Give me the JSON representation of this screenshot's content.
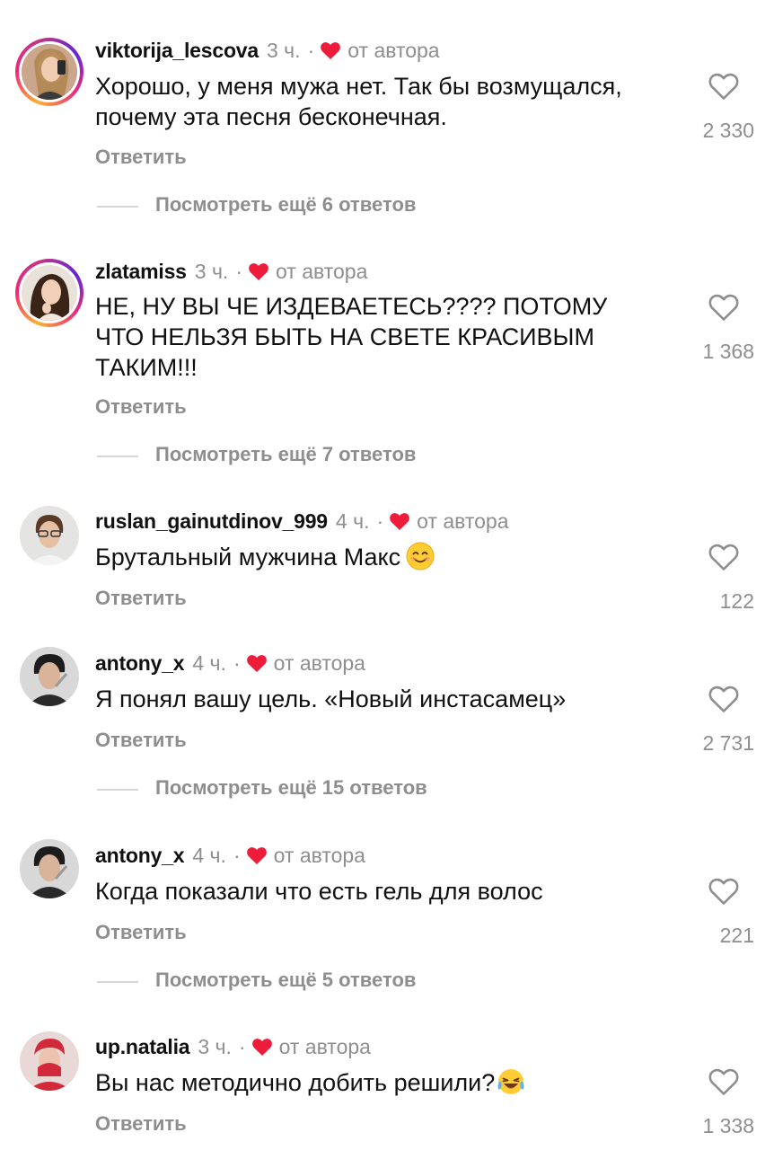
{
  "common": {
    "reply_label": "Ответить",
    "author_label": "от автора",
    "separator": "·"
  },
  "comments": [
    {
      "username": "viktorija_lescova",
      "time": "3 ч.",
      "text": "Хорошо, у меня мужа нет. Так бы возмущался, почему эта песня бесконечная.",
      "likes": "2 330",
      "more_replies": "Посмотреть ещё 6 ответов",
      "avatar": "avatar-photo-woman-blonde"
    },
    {
      "username": "zlatamiss",
      "time": "3 ч.",
      "text": "НЕ, НУ ВЫ ЧЕ ИЗДЕВАЕТЕСЬ???? ПОТОМУ ЧТО НЕЛЬЗЯ БЫТЬ НА СВЕТЕ КРАСИВЫМ ТАКИМ!!!",
      "likes": "1 368",
      "more_replies": "Посмотреть ещё 7 ответов",
      "avatar": "avatar-photo-woman-brunette"
    },
    {
      "username": "ruslan_gainutdinov_999",
      "time": "4 ч.",
      "text": "Брутальный мужчина Макс",
      "emoji": "smiling-face-emoji",
      "likes": "122",
      "avatar": "avatar-photo-man-glasses"
    },
    {
      "username": "antony_x",
      "time": "4 ч.",
      "text": "Я понял вашу цель. «Новый инстасамец»",
      "likes": "2 731",
      "more_replies": "Посмотреть ещё 15 ответов",
      "avatar": "avatar-photo-man-dark"
    },
    {
      "username": "antony_x",
      "time": "4 ч.",
      "text": "Когда показали что есть гель для волос",
      "likes": "221",
      "more_replies": "Посмотреть ещё 5 ответов",
      "avatar": "avatar-photo-man-dark"
    },
    {
      "username": "up.natalia",
      "time": "3 ч.",
      "text": "Вы нас методично добить решили?",
      "emoji": "tears-of-joy-emoji",
      "likes": "1 338",
      "avatar": "avatar-photo-woman-red"
    }
  ],
  "colors": {
    "text": "#111111",
    "secondary": "#8e8e8e",
    "author_heart": "#ed1c3b",
    "divider": "#d6d6d6"
  }
}
